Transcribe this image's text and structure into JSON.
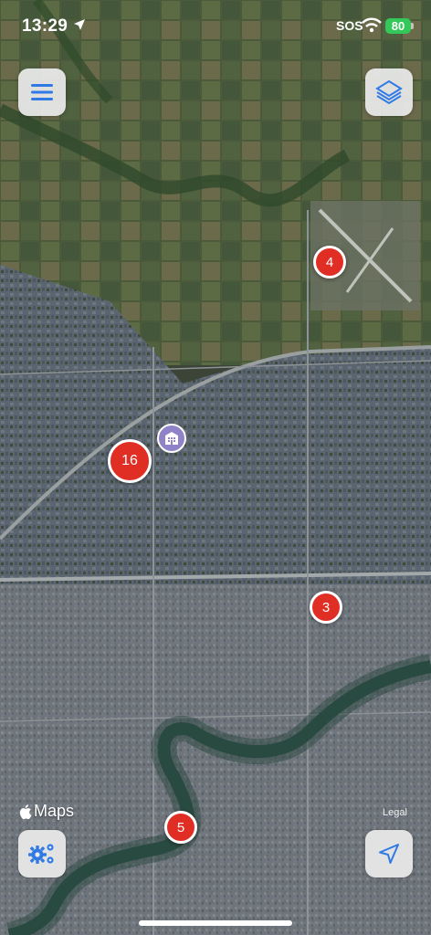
{
  "status_bar": {
    "time": "13:29",
    "sos": "SOS",
    "battery": "80"
  },
  "map": {
    "attribution": "Maps",
    "legal": "Legal",
    "clusters": [
      {
        "count": "4"
      },
      {
        "count": "16"
      },
      {
        "count": "3"
      },
      {
        "count": "5"
      }
    ],
    "colors": {
      "cluster": "#e02e24",
      "facility": "#8f82c6",
      "button_icon": "#2f7ae5"
    }
  },
  "controls": {
    "menu_icon": "hamburger-menu-icon",
    "layers_icon": "layers-icon",
    "settings_icon": "gears-icon",
    "locate_icon": "navigation-arrow-icon"
  }
}
